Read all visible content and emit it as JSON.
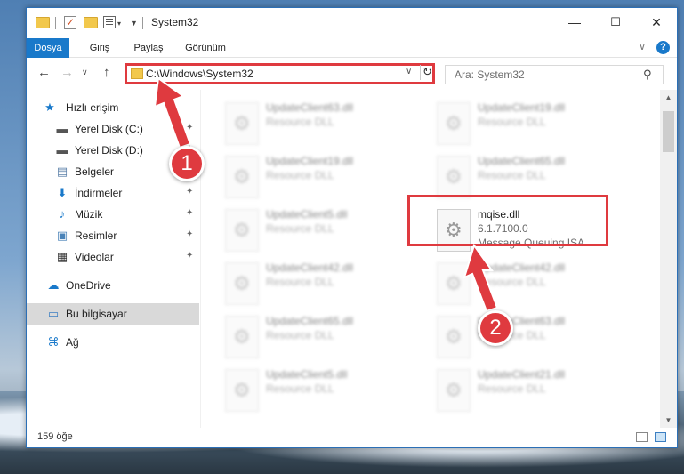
{
  "window": {
    "title": "System32",
    "minimize": "—",
    "maximize": "☐",
    "close": "✕"
  },
  "ribbon": {
    "tabs": [
      "Dosya",
      "Giriş",
      "Paylaş",
      "Görünüm"
    ],
    "help": "?",
    "collapse": "∨"
  },
  "nav": {
    "back": "←",
    "forward": "→",
    "recent": "∨",
    "up": "↑",
    "address": "C:\\Windows\\System32",
    "address_dropdown": "∨",
    "refresh": "↻",
    "search_placeholder": "Ara: System32",
    "search_icon": "⚲"
  },
  "sidebar": {
    "items": [
      {
        "label": "Hızlı erişim",
        "icon": "star-icon",
        "glyph": "★",
        "color": "#1979ca",
        "pinned": false
      },
      {
        "label": "Yerel Disk (C:)",
        "icon": "drive-icon",
        "glyph": "▬",
        "color": "#555555",
        "pinned": true
      },
      {
        "label": "Yerel Disk (D:)",
        "icon": "drive-icon",
        "glyph": "▬",
        "color": "#555555",
        "pinned": true
      },
      {
        "label": "Belgeler",
        "icon": "document-icon",
        "glyph": "▤",
        "color": "#5a7fa8",
        "pinned": true
      },
      {
        "label": "İndirmeler",
        "icon": "download-icon",
        "glyph": "⬇",
        "color": "#1979ca",
        "pinned": true
      },
      {
        "label": "Müzik",
        "icon": "music-icon",
        "glyph": "♪",
        "color": "#1979ca",
        "pinned": true
      },
      {
        "label": "Resimler",
        "icon": "pictures-icon",
        "glyph": "▣",
        "color": "#4a83b8",
        "pinned": true
      },
      {
        "label": "Videolar",
        "icon": "video-icon",
        "glyph": "▦",
        "color": "#333333",
        "pinned": true
      },
      {
        "label": "OneDrive",
        "icon": "cloud-icon",
        "glyph": "☁",
        "color": "#1979ca",
        "pinned": false
      },
      {
        "label": "Bu bilgisayar",
        "icon": "computer-icon",
        "glyph": "▭",
        "color": "#3c7fc2",
        "pinned": false
      },
      {
        "label": "Ağ",
        "icon": "network-icon",
        "glyph": "⌘",
        "color": "#1979ca",
        "pinned": false
      }
    ],
    "pin_glyph": "📌"
  },
  "files": [
    {
      "name": "UpdateClient63.dll",
      "sub": "Resource DLL",
      "desc": ""
    },
    {
      "name": "UpdateClient19.dll",
      "sub": "Resource DLL",
      "desc": ""
    },
    {
      "name": "UpdateClient19.dll",
      "sub": "Resource DLL",
      "desc": ""
    },
    {
      "name": "UpdateClient65.dll",
      "sub": "Resource DLL",
      "desc": ""
    },
    {
      "name": "UpdateClient5.dll",
      "sub": "Resource DLL",
      "desc": ""
    },
    {
      "name": "mqise.dll",
      "sub": "6.1.7100.0",
      "desc": "Message Queuing ISA..."
    },
    {
      "name": "UpdateClient42.dll",
      "sub": "Resource DLL",
      "desc": ""
    },
    {
      "name": "UpdateClient42.dll",
      "sub": "Resource DLL",
      "desc": ""
    },
    {
      "name": "UpdateClient65.dll",
      "sub": "Resource DLL",
      "desc": ""
    },
    {
      "name": "UpdateClient63.dll",
      "sub": "Resource DLL",
      "desc": ""
    },
    {
      "name": "UpdateClient5.dll",
      "sub": "Resource DLL",
      "desc": ""
    },
    {
      "name": "UpdateClient21.dll",
      "sub": "Resource DLL",
      "desc": ""
    }
  ],
  "status": {
    "count": "159 öğe"
  },
  "annotations": {
    "badge1": "1",
    "badge2": "2",
    "color": "#df3a3f"
  }
}
